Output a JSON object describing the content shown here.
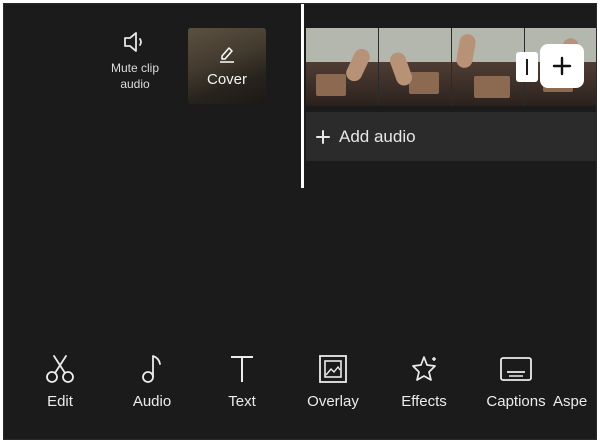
{
  "timeline": {
    "mute_label": "Mute clip audio",
    "cover_label": "Cover",
    "add_audio_label": "Add audio"
  },
  "toolbar": {
    "items": [
      {
        "label": "Edit",
        "icon": "scissors-icon"
      },
      {
        "label": "Audio",
        "icon": "music-note-icon"
      },
      {
        "label": "Text",
        "icon": "text-icon"
      },
      {
        "label": "Overlay",
        "icon": "overlay-icon"
      },
      {
        "label": "Effects",
        "icon": "effects-star-icon"
      },
      {
        "label": "Captions",
        "icon": "captions-icon"
      },
      {
        "label": "Aspe",
        "icon": "aspect-ratio-icon"
      }
    ]
  },
  "colors": {
    "background": "#1b1b1b",
    "track": "#2b2b2b",
    "text": "#ececec",
    "accent": "#ffffff"
  }
}
